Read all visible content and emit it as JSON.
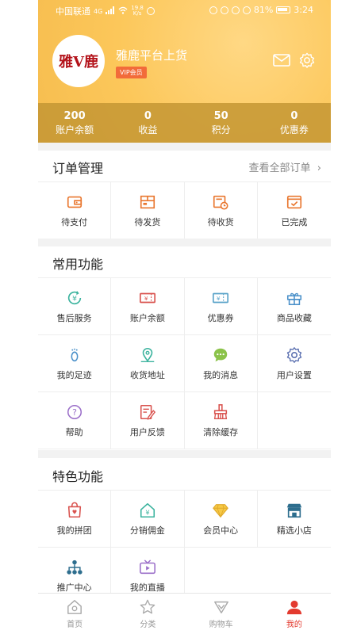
{
  "status_bar": {
    "carrier": "中国联通",
    "network": "4G",
    "speed_value": "19.8",
    "speed_unit": "K/s",
    "battery": "81%",
    "time": "3:24"
  },
  "profile": {
    "avatar_text": "雅V鹿",
    "name": "雅鹿平台上货",
    "badge": "VIP会员"
  },
  "stats": [
    {
      "value": "200",
      "label": "账户余额"
    },
    {
      "value": "0",
      "label": "收益"
    },
    {
      "value": "50",
      "label": "积分"
    },
    {
      "value": "0",
      "label": "优惠券"
    }
  ],
  "orders": {
    "title": "订单管理",
    "view_all": "查看全部订单",
    "items": [
      {
        "label": "待支付",
        "icon": "wallet-icon"
      },
      {
        "label": "待发货",
        "icon": "package-icon"
      },
      {
        "label": "待收货",
        "icon": "delivery-clock-icon"
      },
      {
        "label": "已完成",
        "icon": "completed-check-icon"
      }
    ]
  },
  "common": {
    "title": "常用功能",
    "items": [
      {
        "label": "售后服务",
        "icon": "after-sale-icon"
      },
      {
        "label": "账户余额",
        "icon": "balance-ticket-icon"
      },
      {
        "label": "优惠券",
        "icon": "coupon-icon"
      },
      {
        "label": "商品收藏",
        "icon": "gift-icon"
      },
      {
        "label": "我的足迹",
        "icon": "footprint-icon"
      },
      {
        "label": "收货地址",
        "icon": "map-pin-icon"
      },
      {
        "label": "我的消息",
        "icon": "chat-bubble-icon"
      },
      {
        "label": "用户设置",
        "icon": "gear-icon"
      },
      {
        "label": "帮助",
        "icon": "help-icon"
      },
      {
        "label": "用户反馈",
        "icon": "feedback-icon"
      },
      {
        "label": "清除缓存",
        "icon": "broom-icon"
      }
    ]
  },
  "featured": {
    "title": "特色功能",
    "items": [
      {
        "label": "我的拼团",
        "icon": "group-bag-icon"
      },
      {
        "label": "分销佣金",
        "icon": "commission-house-icon"
      },
      {
        "label": "会员中心",
        "icon": "diamond-icon"
      },
      {
        "label": "精选小店",
        "icon": "shop-icon"
      },
      {
        "label": "推广中心",
        "icon": "network-icon"
      },
      {
        "label": "我的直播",
        "icon": "tv-icon"
      }
    ]
  },
  "tabbar": [
    {
      "label": "首页",
      "icon": "home-icon"
    },
    {
      "label": "分类",
      "icon": "star-icon"
    },
    {
      "label": "购物车",
      "icon": "cart-icon"
    },
    {
      "label": "我的",
      "icon": "profile-icon"
    }
  ],
  "colors": {
    "header": "#fcc75a",
    "accent": "#e33a2f",
    "vip_badge": "#f26b3a"
  }
}
